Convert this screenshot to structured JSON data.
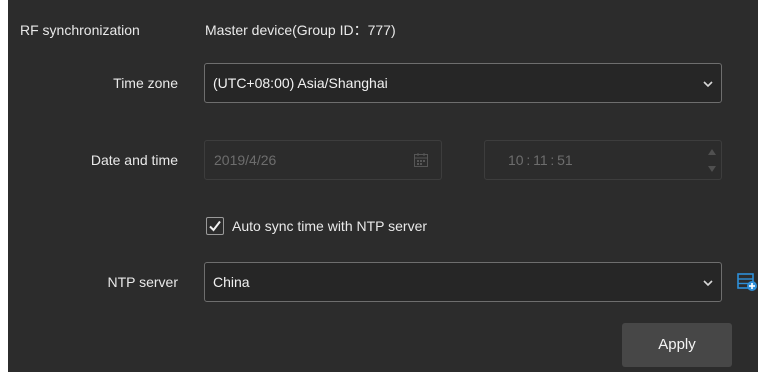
{
  "rf_sync": {
    "label": "RF synchronization",
    "value": "Master device(Group ID：777)"
  },
  "time_zone": {
    "label": "Time zone",
    "value": "(UTC+08:00) Asia/Shanghai"
  },
  "date_time": {
    "label": "Date and time",
    "date": "2019/4/26",
    "time": "10 : 11 : 51"
  },
  "ntp": {
    "checkbox_label": "Auto sync time with NTP server",
    "checked": true,
    "label": "NTP server",
    "value": "China"
  },
  "actions": {
    "apply_label": "Apply"
  },
  "icons": {
    "time_zone_dropdown": "chevron-down-icon",
    "date_picker": "calendar-icon",
    "time_spinner": "spinner-arrows-icon",
    "ntp_dropdown": "chevron-down-icon",
    "ntp_add": "add-server-icon"
  },
  "colors": {
    "panel_background": "#2c2c2c",
    "accent_blue": "#2e8fd8",
    "button_background": "#474747"
  }
}
